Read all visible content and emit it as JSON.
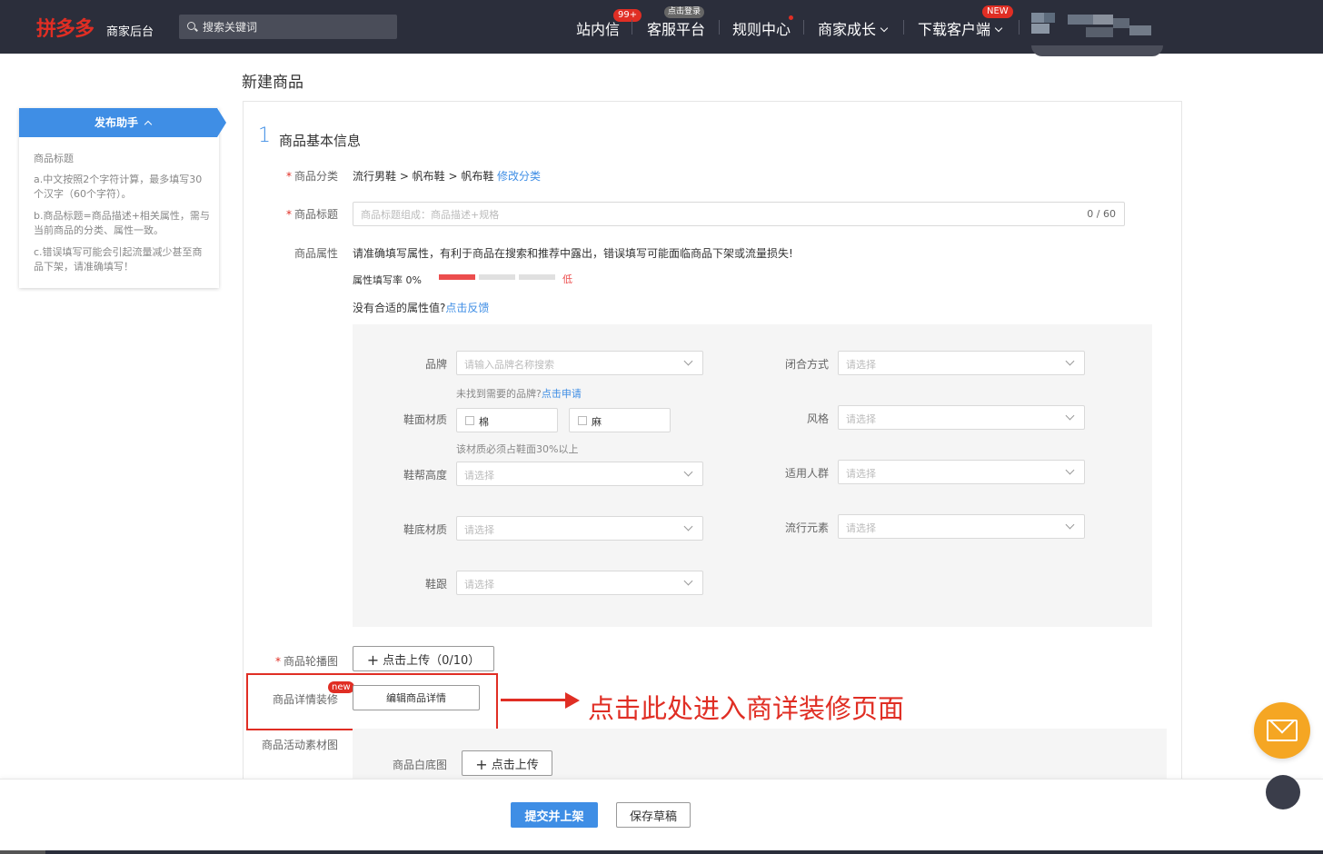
{
  "header": {
    "logo": "拼多多",
    "logo_sub": "商家后台",
    "search_placeholder": "搜索关键词",
    "nav": [
      {
        "label": "站内信",
        "badge": "99+"
      },
      {
        "label": "客服平台",
        "badge": "点击登录"
      },
      {
        "label": "规则中心"
      },
      {
        "label": "商家成长"
      },
      {
        "label": "下载客户端",
        "badge": "NEW"
      }
    ]
  },
  "page_title": "新建商品",
  "helper": {
    "title": "发布助手",
    "subtitle": "商品标题",
    "tips": [
      "a.中文按照2个字符计算，最多填写30个汉字（60个字符）。",
      "b.商品标题=商品描述+相关属性，需与当前商品的分类、属性一致。",
      "c.错误填写可能会引起流量减少甚至商品下架，请准确填写！"
    ]
  },
  "section": {
    "number": "1",
    "title": "商品基本信息"
  },
  "category": {
    "label": "商品分类",
    "path": "流行男鞋 > 帆布鞋 > 帆布鞋",
    "modify": "修改分类"
  },
  "product_title": {
    "label": "商品标题",
    "placeholder": "商品标题组成：商品描述+规格",
    "counter": "0 / 60"
  },
  "attributes": {
    "label": "商品属性",
    "notice": "请准确填写属性，有利于商品在搜索和推荐中露出，错误填写可能面临商品下架或流量损失!",
    "fill_rate_label": "属性填写率 0%",
    "fill_rate_level": "低",
    "fill_rate_percent": 0,
    "feedback_prompt": "没有合适的属性值?",
    "feedback_link": "点击反馈",
    "brand": {
      "label": "品牌",
      "placeholder": "请输入品牌名称搜索",
      "not_found": "未找到需要的品牌?",
      "apply": "点击申请"
    },
    "closure": {
      "label": "闭合方式",
      "placeholder": "请选择"
    },
    "upper_material": {
      "label": "鞋面材质",
      "options": [
        "棉",
        "麻"
      ],
      "hint": "该材质必须占鞋面30%以上"
    },
    "style": {
      "label": "风格",
      "placeholder": "请选择"
    },
    "upper_height": {
      "label": "鞋帮高度",
      "placeholder": "请选择"
    },
    "crowd": {
      "label": "适用人群",
      "placeholder": "请选择"
    },
    "sole_material": {
      "label": "鞋底材质",
      "placeholder": "请选择"
    },
    "fashion": {
      "label": "流行元素",
      "placeholder": "请选择"
    },
    "heel": {
      "label": "鞋跟",
      "placeholder": "请选择"
    }
  },
  "carousel": {
    "label": "商品轮播图",
    "upload": "点击上传（0/10）"
  },
  "detail": {
    "label": "商品详情装修",
    "new_tag": "new",
    "button": "编辑商品详情"
  },
  "annotation": "点击此处进入商详装修页面",
  "activity": {
    "label": "商品活动素材图",
    "white_bg_label": "商品白底图",
    "upload": "点击上传"
  },
  "footer": {
    "submit": "提交并上架",
    "draft": "保存草稿"
  },
  "colors": {
    "accent": "#3f8ee5",
    "brand_red": "#e02e24",
    "header_bg": "#2b2e3b",
    "mail_button": "#f5a623"
  }
}
